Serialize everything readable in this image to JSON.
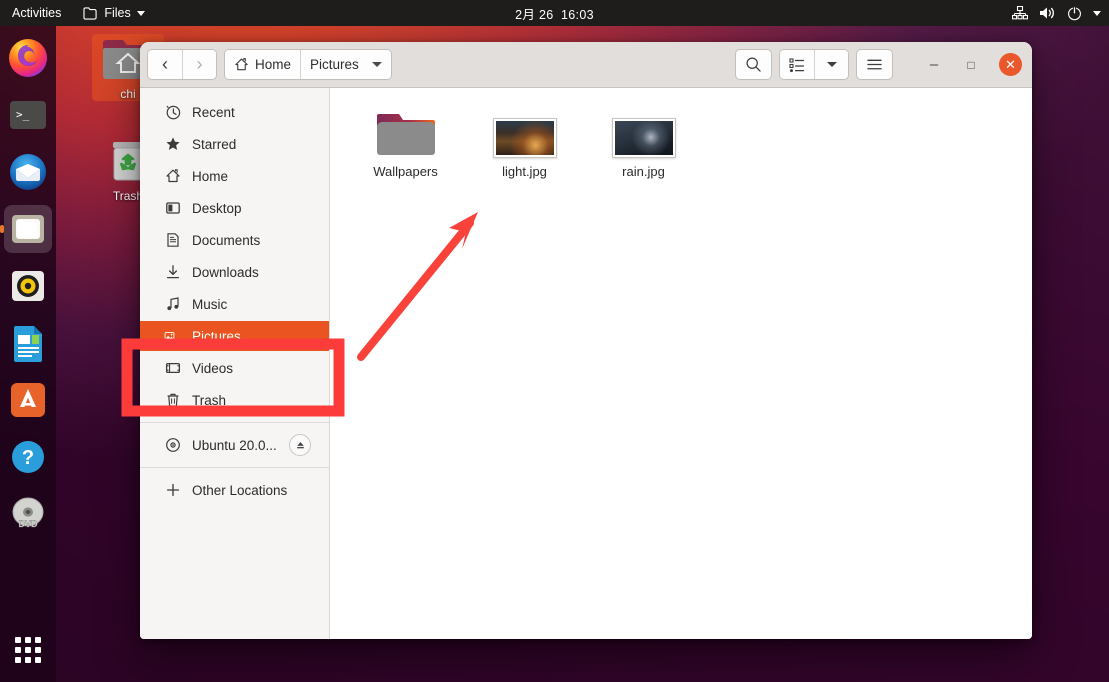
{
  "topbar": {
    "activities": "Activities",
    "app_name": "Files",
    "app_icon": "folder-icon",
    "app_caret": "chevron-down-icon",
    "clock": "2月 26  16:03",
    "indicators": [
      {
        "name": "network-icon"
      },
      {
        "name": "volume-icon"
      },
      {
        "name": "power-icon"
      },
      {
        "name": "chevron-down-icon"
      }
    ]
  },
  "dock": {
    "items": [
      {
        "name": "firefox",
        "label": "Firefox",
        "active": false
      },
      {
        "name": "terminal",
        "label": "Terminal",
        "active": false
      },
      {
        "name": "thunderbird",
        "label": "Thunderbird",
        "active": false
      },
      {
        "name": "files",
        "label": "Files",
        "active": true
      },
      {
        "name": "rhythmbox",
        "label": "Rhythmbox",
        "active": false
      },
      {
        "name": "libreoffice-writer",
        "label": "LibreOffice Writer",
        "active": false
      },
      {
        "name": "ubuntu-software",
        "label": "Ubuntu Software",
        "active": false
      },
      {
        "name": "help",
        "label": "Help",
        "active": false
      },
      {
        "name": "dvd",
        "label": "DVD",
        "active": false
      }
    ],
    "show_apps_label": "Show Applications"
  },
  "desktop": {
    "icons": [
      {
        "name": "home-folder",
        "label": "chi",
        "type": "home"
      },
      {
        "name": "trash",
        "label": "Trash",
        "type": "trash"
      }
    ]
  },
  "window": {
    "nav": {
      "back": "‹",
      "forward": "›"
    },
    "breadcrumb": [
      {
        "label": "Home",
        "icon": "home-icon"
      },
      {
        "label": "Pictures",
        "icon": ""
      }
    ],
    "breadcrumb_caret": "chevron-down-icon",
    "toolbar": {
      "search": "search-icon",
      "view_list": "list-view-icon",
      "view_caret": "chevron-down-icon",
      "menu": "hamburger-menu-icon"
    },
    "controls": {
      "minimize": "–",
      "maximize": "□",
      "close": "✕"
    },
    "sidebar": {
      "items": [
        {
          "label": "Recent",
          "icon": "clock-icon",
          "selected": false,
          "sep_after": false
        },
        {
          "label": "Starred",
          "icon": "star-icon",
          "selected": false,
          "sep_after": false
        },
        {
          "label": "Home",
          "icon": "home-icon",
          "selected": false,
          "sep_after": false
        },
        {
          "label": "Desktop",
          "icon": "desktop-icon",
          "selected": false,
          "sep_after": false
        },
        {
          "label": "Documents",
          "icon": "document-icon",
          "selected": false,
          "sep_after": false
        },
        {
          "label": "Downloads",
          "icon": "download-icon",
          "selected": false,
          "sep_after": false
        },
        {
          "label": "Music",
          "icon": "music-icon",
          "selected": false,
          "sep_after": false
        },
        {
          "label": "Pictures",
          "icon": "pictures-icon",
          "selected": true,
          "sep_after": false
        },
        {
          "label": "Videos",
          "icon": "video-icon",
          "selected": false,
          "sep_after": false
        },
        {
          "label": "Trash",
          "icon": "trash-icon",
          "selected": false,
          "sep_after": true
        },
        {
          "label": "Ubuntu 20.0...",
          "icon": "disc-icon",
          "selected": false,
          "sep_after": true,
          "eject": "eject-icon"
        },
        {
          "label": "Other Locations",
          "icon": "plus-icon",
          "selected": false,
          "sep_after": false
        }
      ]
    },
    "files": [
      {
        "name": "Wallpapers",
        "type": "folder"
      },
      {
        "name": "light.jpg",
        "type": "image-thumb-warm"
      },
      {
        "name": "rain.jpg",
        "type": "image-thumb-cool"
      }
    ]
  },
  "annotations": {
    "highlight_box": {
      "target": "Pictures",
      "color": "#fc3b3b"
    },
    "arrow": {
      "points_to": "light.jpg",
      "color": "#f9423a"
    }
  },
  "colors": {
    "accent_orange": "#e95420",
    "annotation_red": "#fc3b3b",
    "topbar_bg": "#1f1d1c",
    "headerbar_bg": "#e1dedb",
    "sidebar_bg": "#f7f5f4"
  }
}
